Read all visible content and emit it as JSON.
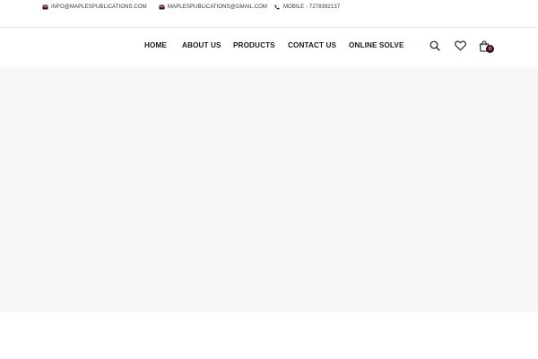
{
  "topbar": {
    "email_info": "INFO@MAPLESPUBLICATIONS.COM",
    "email_gmail": "MAPLESPUBLICATIONS@GMAIL.COM",
    "mobile": "MOBILE - 7278392137",
    "icons": [
      "envelope-icon",
      "envelope-icon",
      "phone-icon"
    ]
  },
  "nav": {
    "items": [
      {
        "label": "HOME"
      },
      {
        "label": "ABOUT US"
      },
      {
        "label": "PRODUCTS"
      },
      {
        "label": "CONTACT US"
      },
      {
        "label": "ONLINE SOLVE"
      }
    ]
  },
  "header_icons": {
    "search": "search-icon",
    "wishlist": "heart-icon",
    "cart": "shopping-bag-icon",
    "cart_count": "0"
  },
  "colors": {
    "accent": "#3a0d22",
    "hero_background": "#f7f7f7",
    "divider": "#e6e6e6"
  }
}
